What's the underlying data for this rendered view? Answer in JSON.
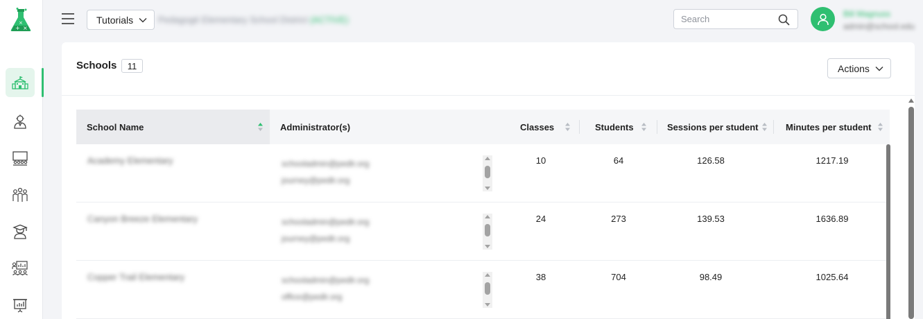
{
  "header": {
    "tutorials_label": "Tutorials",
    "district_name": "Pedagogé Elementary School District",
    "district_tag": "(ACTIVE)",
    "search_placeholder": "Search",
    "user_name": "Bill Magnuss",
    "user_email": "admin@school.edu"
  },
  "card": {
    "title": "Schools",
    "count": "11",
    "actions_label": "Actions"
  },
  "table": {
    "columns": [
      "School Name",
      "Administrator(s)",
      "Classes",
      "Students",
      "Sessions per student",
      "Minutes per student"
    ],
    "rows": [
      {
        "school": "Academy Elementary",
        "admins": [
          "schooladmin@pedlr.org",
          "journey@pedlr.org"
        ],
        "classes": "10",
        "students": "64",
        "sessions": "126.58",
        "minutes": "1217.19"
      },
      {
        "school": "Canyon Breeze Elementary",
        "admins": [
          "schooladmin@pedlr.org",
          "journey@pedlr.org"
        ],
        "classes": "24",
        "students": "273",
        "sessions": "139.53",
        "minutes": "1636.89"
      },
      {
        "school": "Copper Trail Elementary",
        "admins": [
          "schooladmin@pedlr.org",
          "office@pedlr.org"
        ],
        "classes": "38",
        "students": "704",
        "sessions": "98.49",
        "minutes": "1025.64"
      }
    ]
  },
  "colors": {
    "brand_green": "#2fbf71",
    "active_nav_bg": "#e4f5ec",
    "scrollbar": "#7a7a7a"
  },
  "icons": {
    "logo": "flask-logo-icon",
    "nav": [
      "school-icon",
      "teacher-icon",
      "classroom-icon",
      "students-group-icon",
      "graduate-icon",
      "dashboard-icon",
      "presentation-chart-icon"
    ]
  }
}
